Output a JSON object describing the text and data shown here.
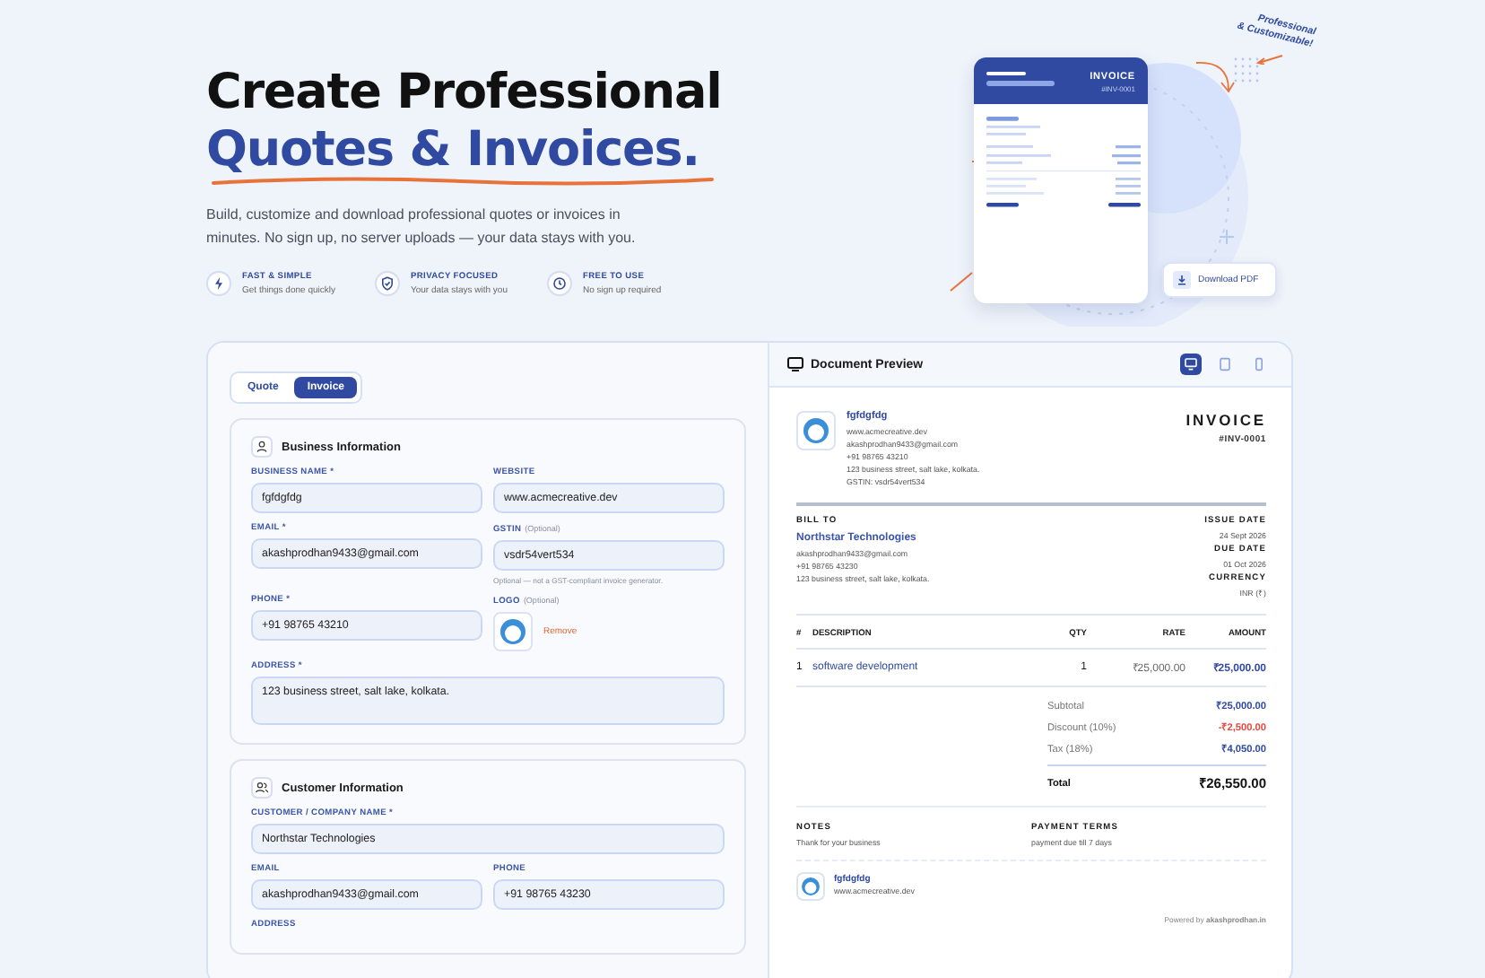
{
  "hero": {
    "title_line1": "Create Professional",
    "title_line2": "Quotes & Invoices.",
    "subtitle": "Build, customize and download professional quotes or invoices in minutes. No sign up, no server uploads — your data stays with you.",
    "features": [
      {
        "kind": "bolt",
        "title": "FAST & SIMPLE",
        "caption": "Get things done quickly"
      },
      {
        "kind": "shield",
        "title": "PRIVACY FOCUSED",
        "caption": "Your data stays with you"
      },
      {
        "kind": "clock",
        "title": "FREE TO USE",
        "caption": "No sign up required"
      }
    ]
  },
  "illustration": {
    "invoice_label": "INVOICE",
    "invoice_number": "#INV-0001",
    "tag_line1": "Professional",
    "tag_line2": "& Customizable!",
    "download_button": "Download PDF"
  },
  "mode_tabs": [
    {
      "label": "Quote",
      "selected": false
    },
    {
      "label": "Invoice",
      "selected": true
    }
  ],
  "sections": [
    {
      "kind": "person",
      "title": "Business Information",
      "fields": [
        {
          "kind": "input",
          "label": "BUSINESS NAME *",
          "value": "fgfdgfdg"
        },
        {
          "kind": "input",
          "label": "WEBSITE",
          "value": "www.acmecreative.dev"
        },
        {
          "kind": "input",
          "label": "EMAIL *",
          "value": "akashprodhan9433@gmail.com"
        },
        {
          "kind": "input",
          "label": "GSTIN",
          "optional": "(Optional)",
          "value": "vsdr54vert534",
          "hint": "Optional — not a GST-compliant invoice generator."
        },
        {
          "kind": "input",
          "label": "PHONE *",
          "value": "+91 98765 43210"
        },
        {
          "kind": "logo",
          "label": "LOGO",
          "optional": "(Optional)",
          "action": "Remove"
        },
        {
          "kind": "textarea",
          "label": "ADDRESS *",
          "value": "123 business street, salt lake, kolkata."
        }
      ]
    },
    {
      "kind": "people",
      "title": "Customer Information",
      "fields": [
        {
          "kind": "input",
          "wide": true,
          "label": "CUSTOMER / COMPANY NAME *",
          "value": "Northstar Technologies"
        },
        {
          "kind": "input",
          "label": "EMAIL",
          "value": "akashprodhan9433@gmail.com"
        },
        {
          "kind": "input",
          "label": "PHONE",
          "value": "+91 98765 43230"
        },
        {
          "kind": "label",
          "label": "ADDRESS"
        }
      ]
    }
  ],
  "preview": {
    "title": "Document Preview",
    "view_buttons": [
      {
        "kind": "desktop",
        "selected": true
      },
      {
        "kind": "tablet",
        "selected": false
      },
      {
        "kind": "mobile",
        "selected": false
      }
    ],
    "business": {
      "name": "fgfdgfdg",
      "lines": [
        "www.acmecreative.dev",
        "akashprodhan9433@gmail.com",
        "+91 98765 43210",
        "123 business street, salt lake, kolkata.",
        "GSTIN: vsdr54vert534"
      ]
    },
    "doc_title": "INVOICE",
    "doc_number": "#INV-0001",
    "bill_to_label": "BILL TO",
    "client": {
      "name": "Northstar Technologies",
      "lines": [
        "akashprodhan9433@gmail.com",
        "+91 98765 43230",
        "123 business street, salt lake, kolkata."
      ]
    },
    "meta": [
      {
        "label": "ISSUE DATE",
        "value": "24 Sept 2026"
      },
      {
        "label": "DUE DATE",
        "value": "01 Oct 2026"
      },
      {
        "label": "CURRENCY",
        "value": "INR (₹)"
      }
    ],
    "columns": [
      "#",
      "DESCRIPTION",
      "QTY",
      "RATE",
      "AMOUNT"
    ],
    "rows": [
      [
        "1",
        "software development",
        "1",
        "₹25,000.00",
        "₹25,000.00"
      ]
    ],
    "totals": [
      {
        "kind": "normal",
        "label": "Subtotal",
        "value": "₹25,000.00"
      },
      {
        "kind": "discount",
        "label": "Discount (10%)",
        "value": "-₹2,500.00"
      },
      {
        "kind": "normal",
        "label": "Tax (18%)",
        "value": "₹4,050.00"
      }
    ],
    "total": {
      "label": "Total",
      "value": "₹26,550.00"
    },
    "notes_label": "NOTES",
    "notes": "Thank for your business",
    "terms_label": "PAYMENT TERMS",
    "terms": "payment due till 7 days",
    "footer": {
      "name": "fgfdgfdg",
      "website": "www.acmecreative.dev"
    },
    "powered": "Powered by **akashprodhan.in**"
  }
}
